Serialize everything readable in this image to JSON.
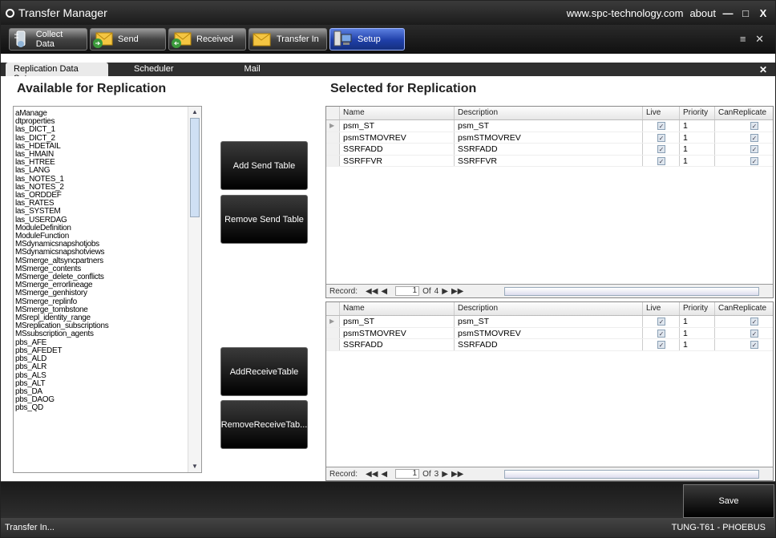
{
  "window": {
    "title": "Transfer Manager",
    "site_link": "www.spc-technology.com",
    "about": "about",
    "minimize": "—",
    "maximize": "□",
    "close": "X"
  },
  "toolbar": {
    "buttons": [
      "Collect Data",
      "Send",
      "Received",
      "Transfer In",
      "Setup"
    ],
    "active": "Setup",
    "pin": "≡ ✕"
  },
  "tabs": {
    "items": [
      "Replication Data Setup",
      "Scheduler",
      "Mail"
    ],
    "selected": "Replication Data Setup",
    "close": "✕"
  },
  "available": {
    "heading": "Available for Replication",
    "items": [
      "aManage",
      "dtproperties",
      "las_DICT_1",
      "las_DICT_2",
      "las_HDETAIL",
      "las_HMAIN",
      "las_HTREE",
      "las_LANG",
      "las_NOTES_1",
      "las_NOTES_2",
      "las_ORDDEF",
      "las_RATES",
      "las_SYSTEM",
      "las_USERDAG",
      "ModuleDefinition",
      "ModuleFunction",
      "MSdynamicsnapshotjobs",
      "MSdynamicsnapshotviews",
      "MSmerge_altsyncpartners",
      "MSmerge_contents",
      "MSmerge_delete_conflicts",
      "MSmerge_errorlineage",
      "MSmerge_genhistory",
      "MSmerge_replinfo",
      "MSmerge_tombstone",
      "MSrepl_identity_range",
      "MSreplication_subscriptions",
      "MSsubscription_agents",
      "pbs_AFE",
      "pbs_AFEDET",
      "pbs_ALD",
      "pbs_ALR",
      "pbs_ALS",
      "pbs_ALT",
      "pbs_DA",
      "pbs_DAOG",
      "pbs_QD"
    ]
  },
  "buttons": {
    "add_send": "Add Send Table",
    "remove_send": "Remove Send Table",
    "add_receive": "AddReceiveTable",
    "remove_receive": "RemoveReceiveTab..."
  },
  "selected": {
    "heading": "Selected for Replication",
    "columns": [
      "Name",
      "Description",
      "Live",
      "Priority",
      "CanReplicate"
    ],
    "send_rows": [
      {
        "name": "psm_ST",
        "description": "psm_ST",
        "live": true,
        "priority": "1",
        "can_replicate": true
      },
      {
        "name": "psmSTMOVREV",
        "description": "psmSTMOVREV",
        "live": true,
        "priority": "1",
        "can_replicate": true
      },
      {
        "name": "SSRFADD",
        "description": "SSRFADD",
        "live": true,
        "priority": "1",
        "can_replicate": true
      },
      {
        "name": "SSRFFVR",
        "description": "SSRFFVR",
        "live": true,
        "priority": "1",
        "can_replicate": true
      }
    ],
    "send_nav": {
      "record_label": "Record:",
      "page": "1",
      "of_label": "Of",
      "total": "4"
    },
    "receive_rows": [
      {
        "name": "psm_ST",
        "description": "psm_ST",
        "live": true,
        "priority": "1",
        "can_replicate": true
      },
      {
        "name": "psmSTMOVREV",
        "description": "psmSTMOVREV",
        "live": true,
        "priority": "1",
        "can_replicate": true
      },
      {
        "name": "SSRFADD",
        "description": "SSRFADD",
        "live": true,
        "priority": "1",
        "can_replicate": true
      }
    ],
    "receive_nav": {
      "record_label": "Record:",
      "page": "1",
      "of_label": "Of",
      "total": "3"
    }
  },
  "save": {
    "label": "Save"
  },
  "status": {
    "left": "Transfer In...",
    "right": "TUNG-T61 - PHOEBUS"
  },
  "colors": {
    "titlebar": "#2a2a2a",
    "active_tab": "#2a4fc0",
    "button_bg": "#000000"
  }
}
